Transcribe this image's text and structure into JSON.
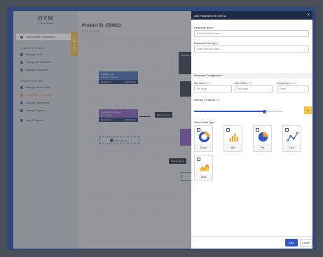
{
  "sidebar": {
    "logo": "DYM",
    "logo_sub": "IoT Technologies",
    "overall": "Overall Stats / Dashboard",
    "company_section": "COMPANY SETTINGS",
    "company_items": [
      "Manage Users",
      "Manage Access Roles",
      "Manage Companies"
    ],
    "product_section": "PRODUCT SETTINGS",
    "product_items": [
      "Manage Sensor Data",
      "Visualization Templates",
      "Solution Deployment",
      "Manage Devices"
    ],
    "support": "Help & Support",
    "template_tab": "TEMPLATE"
  },
  "main": {
    "product_title": "Product ID: EB4923",
    "product_sub": "Device Information",
    "nodes": {
      "gateway_title": "Gateway Type",
      "gateway_sub": "Windows Machine",
      "sensors": "Sensors: 0",
      "add_sensor": "+ Add Sensor",
      "logical_title": "Logical Entity Name 1",
      "logical_sub": "Entry Name",
      "select_node": "Select node E",
      "add_gateway": "Add Gateway",
      "template_name": "Template N"
    }
  },
  "panel": {
    "title": "Add Parameter for DHT11",
    "param_name_label": "Parameter Name",
    "param_name_placeholder": "Enter Parameter Name",
    "unit_label": "Parameter Unit Type",
    "unit_placeholder": "Enter Parameter Name",
    "config_label": "Parameter Configuration",
    "min_label": "Min Value",
    "min_unit": "(°C)",
    "min_placeholder": "Min range",
    "max_label": "Max Value",
    "max_unit": "(°C)",
    "max_placeholder": "Max range",
    "freq_label": "Frequency",
    "freq_unit": "(mins)",
    "freq_placeholder": "Select",
    "warning_label": "Warning Threshold",
    "warning_unit": "(%)",
    "warning_value": "80",
    "warning_percent": 80,
    "chart_label": "Select Chart Type",
    "charts": [
      "Donut",
      "Bar",
      "Pie",
      "Line",
      "Area"
    ],
    "save": "Save",
    "cancel": "Cancel"
  },
  "colors": {
    "primary": "#2f55c8",
    "header": "#1f2a44",
    "accent": "#f5c542",
    "chart_orange": "#f0a020",
    "chart_blue": "#2f55c8"
  }
}
